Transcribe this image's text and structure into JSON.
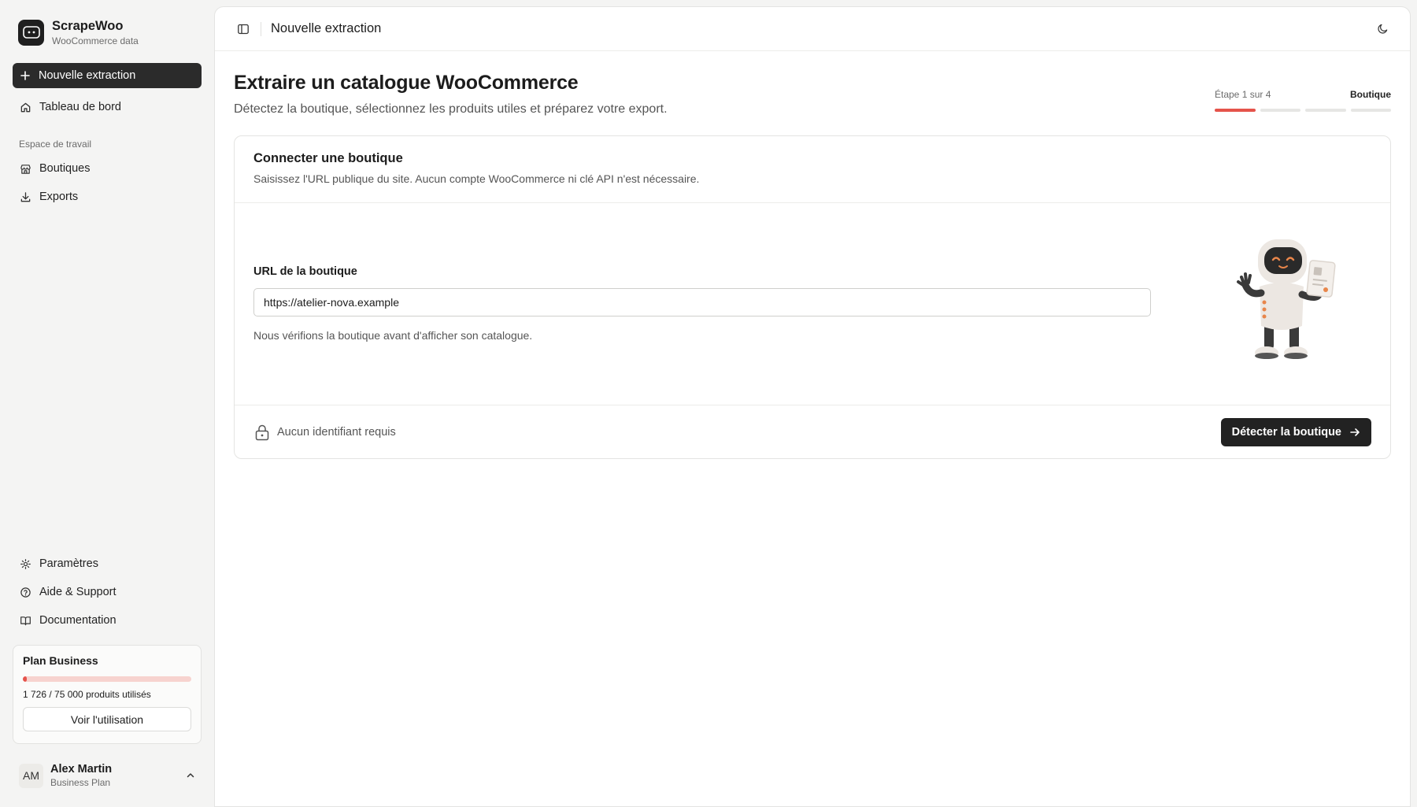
{
  "app": {
    "name": "ScrapeWoo",
    "tagline": "WooCommerce data"
  },
  "sidebar": {
    "primary": [
      {
        "label": "Nouvelle extraction",
        "icon": "plus-icon",
        "active": true
      },
      {
        "label": "Tableau de bord",
        "icon": "home-icon",
        "active": false
      }
    ],
    "section_label": "Espace de travail",
    "workspace": [
      {
        "label": "Boutiques",
        "icon": "store-icon"
      },
      {
        "label": "Exports",
        "icon": "download-icon"
      }
    ],
    "bottom": [
      {
        "label": "Paramètres",
        "icon": "gear-icon"
      },
      {
        "label": "Aide & Support",
        "icon": "help-circle-icon"
      },
      {
        "label": "Documentation",
        "icon": "book-icon"
      }
    ]
  },
  "plan": {
    "title": "Plan Business",
    "usage_text": "1 726 / 75 000 produits utilisés",
    "used": 1726,
    "limit": 75000,
    "button_label": "Voir l'utilisation"
  },
  "user": {
    "initials": "AM",
    "name": "Alex Martin",
    "plan": "Business Plan"
  },
  "topbar": {
    "title": "Nouvelle extraction"
  },
  "page": {
    "title": "Extraire un catalogue WooCommerce",
    "subtitle": "Détectez la boutique, sélectionnez les produits utiles et préparez votre export."
  },
  "stepper": {
    "counter": "Étape 1 sur 4",
    "current_name": "Boutique",
    "current": 1,
    "total": 4
  },
  "card": {
    "title": "Connecter une boutique",
    "description": "Saisissez l'URL publique du site. Aucun compte WooCommerce ni clé API n'est nécessaire.",
    "field_label": "URL de la boutique",
    "url_value": "https://atelier-nova.example",
    "hint": "Nous vérifions la boutique avant d'afficher son catalogue.",
    "footer_note": "Aucun identifiant requis",
    "cta_label": "Détecter la boutique"
  },
  "colors": {
    "accent": "#e5534b",
    "dark": "#222222"
  }
}
